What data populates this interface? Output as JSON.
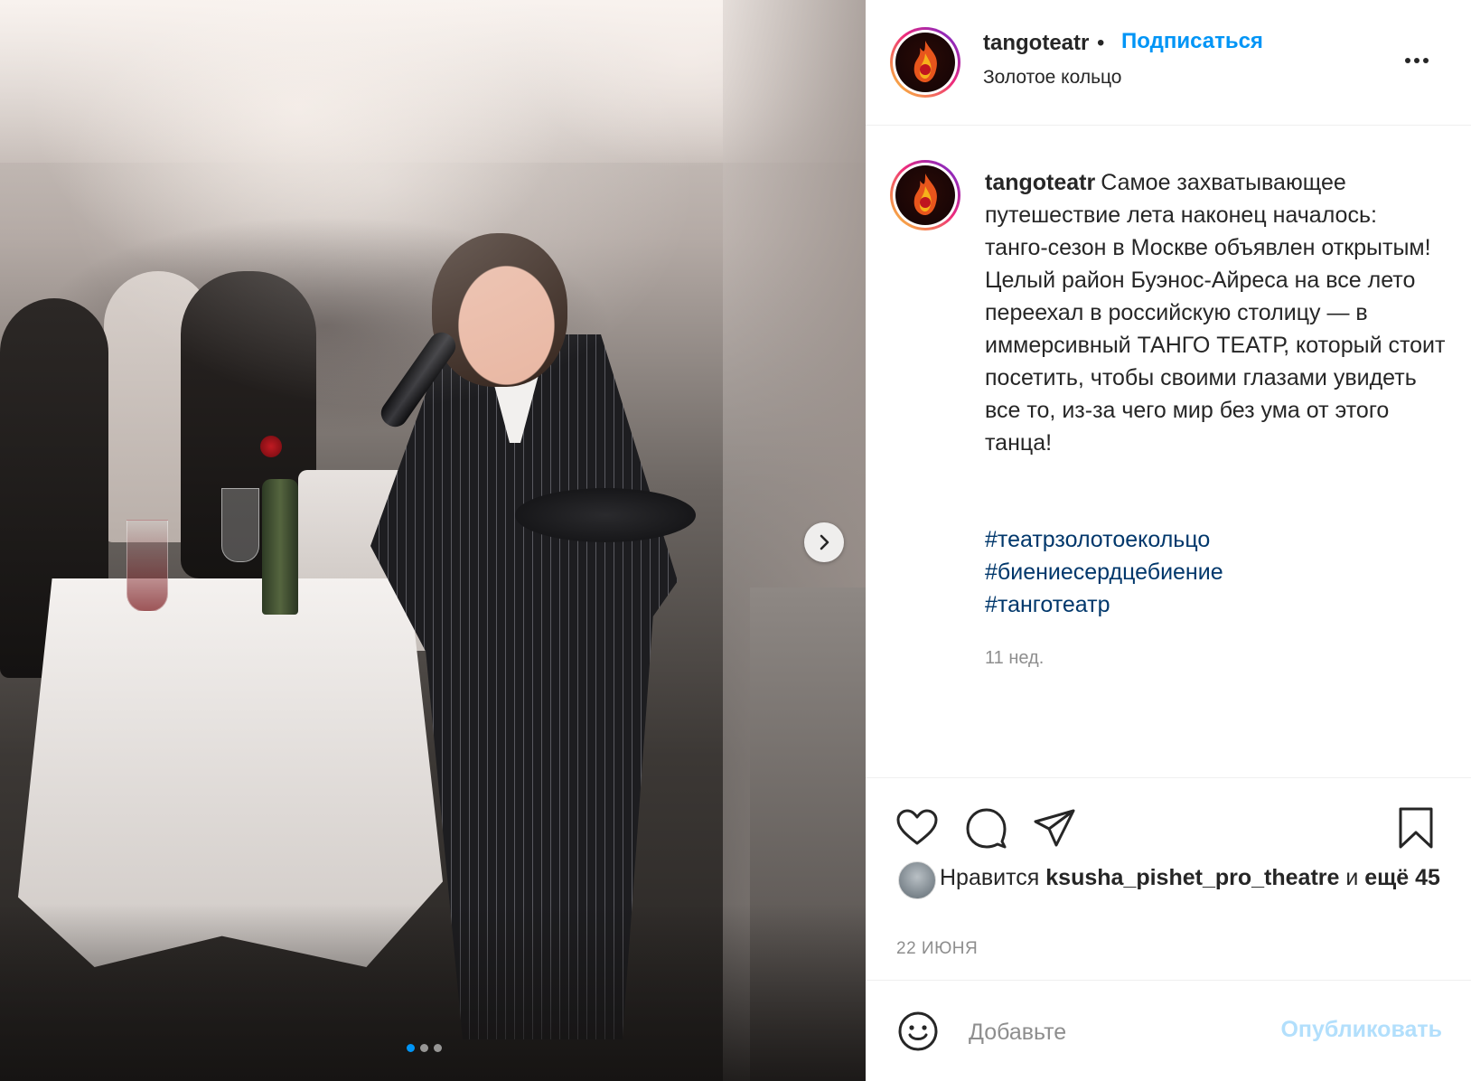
{
  "header": {
    "username": "tangoteatr",
    "separator": "•",
    "follow_label": "Подписаться",
    "location": "Золотое кольцо",
    "more_icon": "more-horizontal-icon"
  },
  "post": {
    "caption_username": "tangoteatr",
    "caption_text": "Самое захватывающее путешествие лета наконец началось: танго-сезон в Москве объявлен открытым! Целый район Буэнос-Айреса на все лето переехал в российскую столицу — в иммерсивный ТАНГО ТЕАТР, который стоит посетить, чтобы своими глазами увидеть все то, из-за чего мир без ума от этого танца!",
    "hashtags": [
      "#театрзолотоекольцо",
      "#биениесердцебиение",
      "#танготеатр"
    ],
    "time_ago": "11 нед."
  },
  "carousel": {
    "slide_count": 3,
    "active_index": 0,
    "next_icon": "chevron-right-icon"
  },
  "actions": {
    "like_icon": "heart-icon",
    "comment_icon": "comment-bubble-icon",
    "share_icon": "paper-plane-icon",
    "save_icon": "bookmark-icon"
  },
  "likes": {
    "prefix": "Нравится",
    "user": "ksusha_pishet_pro_theatre",
    "conjunction": "и",
    "others": "ещё 45"
  },
  "date": "22 ИЮНЯ",
  "comment": {
    "placeholder": "Добавьте",
    "publish_label": "Опубликовать",
    "emoji_icon": "smiley-icon"
  },
  "colors": {
    "accent": "#0095f6",
    "hashtag": "#00376b",
    "muted": "#8e8e8e",
    "publish_disabled": "#b2dffc"
  }
}
